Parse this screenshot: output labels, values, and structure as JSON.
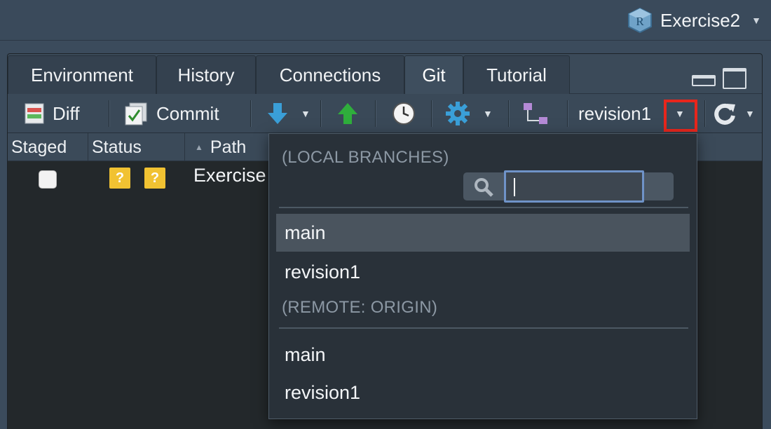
{
  "project": {
    "name": "Exercise2"
  },
  "tabs": [
    {
      "label": "Environment"
    },
    {
      "label": "History"
    },
    {
      "label": "Connections"
    },
    {
      "label": "Git"
    },
    {
      "label": "Tutorial"
    }
  ],
  "toolbar": {
    "diff_label": "Diff",
    "commit_label": "Commit",
    "branch_label": "revision1"
  },
  "columns": {
    "staged": "Staged",
    "status": "Status",
    "path": "Path"
  },
  "files": [
    {
      "staged": false,
      "status": [
        "?",
        "?"
      ],
      "path": "Exercise"
    }
  ],
  "branch_menu": {
    "local_header": "(LOCAL BRANCHES)",
    "search_value": "",
    "local_branches": [
      {
        "label": "main",
        "selected": true
      },
      {
        "label": "revision1",
        "selected": false
      }
    ],
    "remote_header": "(REMOTE: ORIGIN)",
    "remote_branches": [
      {
        "label": "main"
      },
      {
        "label": "revision1"
      }
    ]
  },
  "colors": {
    "highlight": "#e8261c",
    "status_badge": "#f1c232",
    "pull_arrow": "#3a9fd8",
    "push_arrow": "#2fae3c"
  },
  "icons": [
    "r-project-icon",
    "diff-icon",
    "commit-icon",
    "pull-icon",
    "push-icon",
    "history-clock-icon",
    "gear-icon",
    "new-branch-icon",
    "refresh-icon",
    "search-icon"
  ]
}
